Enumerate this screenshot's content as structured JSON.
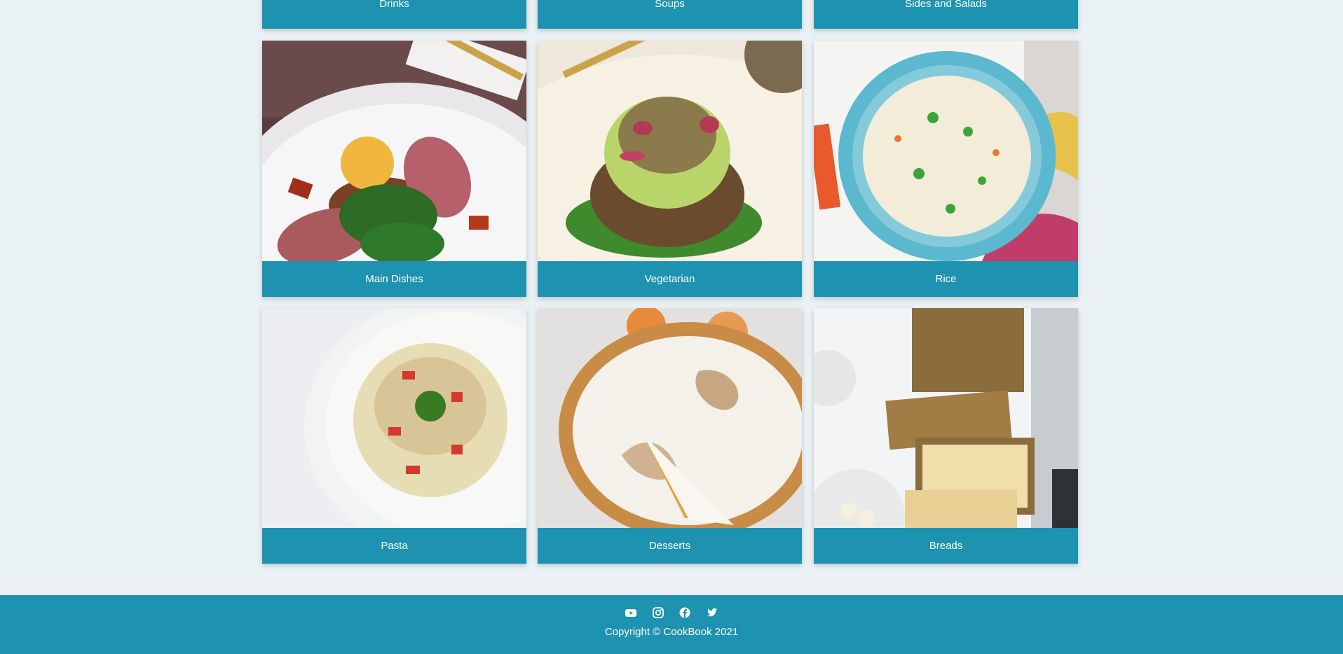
{
  "categories_top": [
    {
      "label": "Drinks"
    },
    {
      "label": "Soups"
    },
    {
      "label": "Sides and Salads"
    }
  ],
  "categories": [
    {
      "label": "Main Dishes",
      "image": "main-dishes-photo"
    },
    {
      "label": "Vegetarian",
      "image": "vegetarian-photo"
    },
    {
      "label": "Rice",
      "image": "rice-photo"
    },
    {
      "label": "Pasta",
      "image": "pasta-photo"
    },
    {
      "label": "Desserts",
      "image": "desserts-photo"
    },
    {
      "label": "Breads",
      "image": "breads-photo"
    }
  ],
  "footer": {
    "socials": [
      "youtube-icon",
      "instagram-icon",
      "facebook-icon",
      "twitter-icon"
    ],
    "copyright": "Copyright © CookBook 2021"
  },
  "colors": {
    "accent": "#1e93b1",
    "background": "#eaf1f4"
  }
}
